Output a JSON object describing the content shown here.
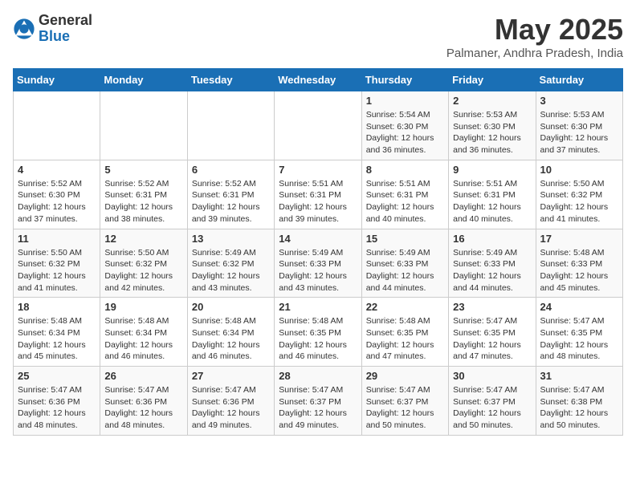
{
  "logo": {
    "general": "General",
    "blue": "Blue"
  },
  "title": "May 2025",
  "location": "Palmaner, Andhra Pradesh, India",
  "days_of_week": [
    "Sunday",
    "Monday",
    "Tuesday",
    "Wednesday",
    "Thursday",
    "Friday",
    "Saturday"
  ],
  "weeks": [
    [
      {
        "day": "",
        "info": ""
      },
      {
        "day": "",
        "info": ""
      },
      {
        "day": "",
        "info": ""
      },
      {
        "day": "",
        "info": ""
      },
      {
        "day": "1",
        "info": "Sunrise: 5:54 AM\nSunset: 6:30 PM\nDaylight: 12 hours\nand 36 minutes."
      },
      {
        "day": "2",
        "info": "Sunrise: 5:53 AM\nSunset: 6:30 PM\nDaylight: 12 hours\nand 36 minutes."
      },
      {
        "day": "3",
        "info": "Sunrise: 5:53 AM\nSunset: 6:30 PM\nDaylight: 12 hours\nand 37 minutes."
      }
    ],
    [
      {
        "day": "4",
        "info": "Sunrise: 5:52 AM\nSunset: 6:30 PM\nDaylight: 12 hours\nand 37 minutes."
      },
      {
        "day": "5",
        "info": "Sunrise: 5:52 AM\nSunset: 6:31 PM\nDaylight: 12 hours\nand 38 minutes."
      },
      {
        "day": "6",
        "info": "Sunrise: 5:52 AM\nSunset: 6:31 PM\nDaylight: 12 hours\nand 39 minutes."
      },
      {
        "day": "7",
        "info": "Sunrise: 5:51 AM\nSunset: 6:31 PM\nDaylight: 12 hours\nand 39 minutes."
      },
      {
        "day": "8",
        "info": "Sunrise: 5:51 AM\nSunset: 6:31 PM\nDaylight: 12 hours\nand 40 minutes."
      },
      {
        "day": "9",
        "info": "Sunrise: 5:51 AM\nSunset: 6:31 PM\nDaylight: 12 hours\nand 40 minutes."
      },
      {
        "day": "10",
        "info": "Sunrise: 5:50 AM\nSunset: 6:32 PM\nDaylight: 12 hours\nand 41 minutes."
      }
    ],
    [
      {
        "day": "11",
        "info": "Sunrise: 5:50 AM\nSunset: 6:32 PM\nDaylight: 12 hours\nand 41 minutes."
      },
      {
        "day": "12",
        "info": "Sunrise: 5:50 AM\nSunset: 6:32 PM\nDaylight: 12 hours\nand 42 minutes."
      },
      {
        "day": "13",
        "info": "Sunrise: 5:49 AM\nSunset: 6:32 PM\nDaylight: 12 hours\nand 43 minutes."
      },
      {
        "day": "14",
        "info": "Sunrise: 5:49 AM\nSunset: 6:33 PM\nDaylight: 12 hours\nand 43 minutes."
      },
      {
        "day": "15",
        "info": "Sunrise: 5:49 AM\nSunset: 6:33 PM\nDaylight: 12 hours\nand 44 minutes."
      },
      {
        "day": "16",
        "info": "Sunrise: 5:49 AM\nSunset: 6:33 PM\nDaylight: 12 hours\nand 44 minutes."
      },
      {
        "day": "17",
        "info": "Sunrise: 5:48 AM\nSunset: 6:33 PM\nDaylight: 12 hours\nand 45 minutes."
      }
    ],
    [
      {
        "day": "18",
        "info": "Sunrise: 5:48 AM\nSunset: 6:34 PM\nDaylight: 12 hours\nand 45 minutes."
      },
      {
        "day": "19",
        "info": "Sunrise: 5:48 AM\nSunset: 6:34 PM\nDaylight: 12 hours\nand 46 minutes."
      },
      {
        "day": "20",
        "info": "Sunrise: 5:48 AM\nSunset: 6:34 PM\nDaylight: 12 hours\nand 46 minutes."
      },
      {
        "day": "21",
        "info": "Sunrise: 5:48 AM\nSunset: 6:35 PM\nDaylight: 12 hours\nand 46 minutes."
      },
      {
        "day": "22",
        "info": "Sunrise: 5:48 AM\nSunset: 6:35 PM\nDaylight: 12 hours\nand 47 minutes."
      },
      {
        "day": "23",
        "info": "Sunrise: 5:47 AM\nSunset: 6:35 PM\nDaylight: 12 hours\nand 47 minutes."
      },
      {
        "day": "24",
        "info": "Sunrise: 5:47 AM\nSunset: 6:35 PM\nDaylight: 12 hours\nand 48 minutes."
      }
    ],
    [
      {
        "day": "25",
        "info": "Sunrise: 5:47 AM\nSunset: 6:36 PM\nDaylight: 12 hours\nand 48 minutes."
      },
      {
        "day": "26",
        "info": "Sunrise: 5:47 AM\nSunset: 6:36 PM\nDaylight: 12 hours\nand 48 minutes."
      },
      {
        "day": "27",
        "info": "Sunrise: 5:47 AM\nSunset: 6:36 PM\nDaylight: 12 hours\nand 49 minutes."
      },
      {
        "day": "28",
        "info": "Sunrise: 5:47 AM\nSunset: 6:37 PM\nDaylight: 12 hours\nand 49 minutes."
      },
      {
        "day": "29",
        "info": "Sunrise: 5:47 AM\nSunset: 6:37 PM\nDaylight: 12 hours\nand 50 minutes."
      },
      {
        "day": "30",
        "info": "Sunrise: 5:47 AM\nSunset: 6:37 PM\nDaylight: 12 hours\nand 50 minutes."
      },
      {
        "day": "31",
        "info": "Sunrise: 5:47 AM\nSunset: 6:38 PM\nDaylight: 12 hours\nand 50 minutes."
      }
    ]
  ]
}
